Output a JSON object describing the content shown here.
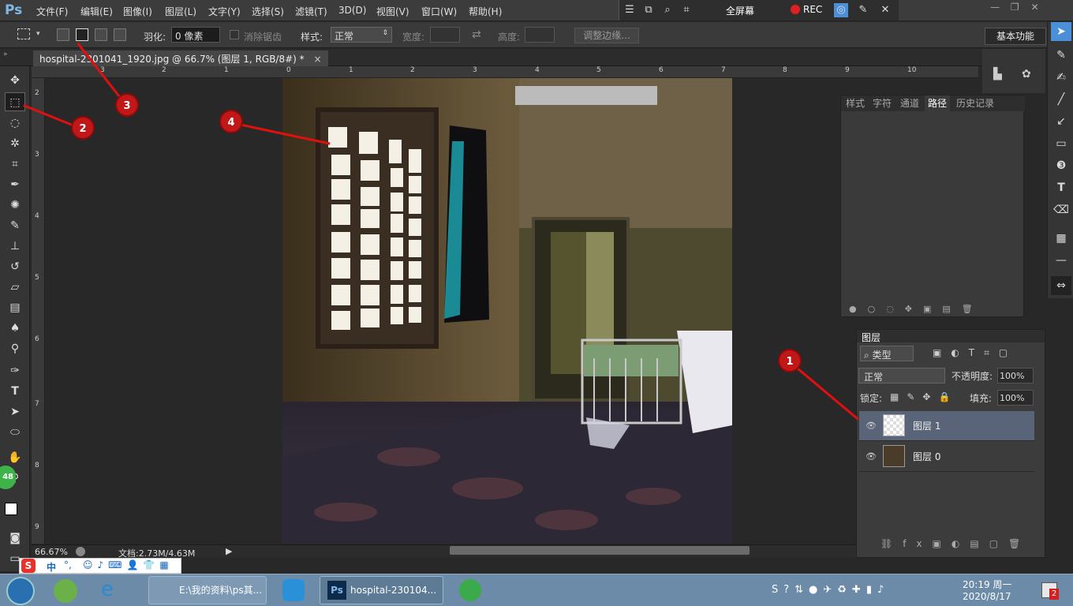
{
  "app": {
    "logo": "Ps"
  },
  "menu": [
    "文件(F)",
    "编辑(E)",
    "图像(I)",
    "图层(L)",
    "文字(Y)",
    "选择(S)",
    "滤镜(T)",
    "3D(D)",
    "视图(V)",
    "窗口(W)",
    "帮助(H)"
  ],
  "recorder": {
    "fullscreen": "全屏幕",
    "rec": "REC"
  },
  "options": {
    "feather_label": "羽化:",
    "feather_value": "0 像素",
    "antialias_label": "消除锯齿",
    "style_label": "样式:",
    "style_value": "正常",
    "width_label": "宽度:",
    "height_label": "高度:",
    "refine_edge": "调整边缘...",
    "workspace": "基本功能"
  },
  "document": {
    "tab_title": "hospital-2301041_1920.jpg @ 66.7% (图层 1, RGB/8#) *",
    "tab_close": "×"
  },
  "ruler": {
    "top_ticks": [
      "3",
      "2",
      "1",
      "0",
      "1",
      "2",
      "3",
      "4",
      "5",
      "6",
      "7",
      "8",
      "9",
      "10"
    ],
    "left_ticks": [
      "2",
      "3",
      "4",
      "5",
      "6",
      "7",
      "8",
      "9"
    ]
  },
  "status": {
    "zoom": "66.67%",
    "doc": "文档:2.73M/4.63M"
  },
  "upper_panel": {
    "tabs": [
      "样式",
      "字符",
      "通道",
      "路径",
      "历史记录"
    ],
    "active": "路径"
  },
  "layers_panel": {
    "title": "图层",
    "filter": "类型",
    "blend_mode": "正常",
    "opacity_label": "不透明度:",
    "opacity_value": "100%",
    "lock_label": "锁定:",
    "fill_label": "填充:",
    "fill_value": "100%",
    "layers": [
      {
        "name": "图层 1",
        "selected": true
      },
      {
        "name": "图层 0",
        "selected": false
      }
    ]
  },
  "annotations": [
    "1",
    "2",
    "3",
    "4"
  ],
  "green_badge": "48",
  "ime": {
    "items": [
      "中",
      "°,"
    ]
  },
  "taskbar": {
    "tasks": [
      "E:\\我的资料\\ps其...",
      "hospital-230104..."
    ],
    "time": "20:19 周一",
    "date": "2020/8/17",
    "notify_count": "2"
  },
  "colors": {
    "accent": "#4a8fd8",
    "annotation": "#c01818",
    "panel": "#3c3c3c"
  }
}
